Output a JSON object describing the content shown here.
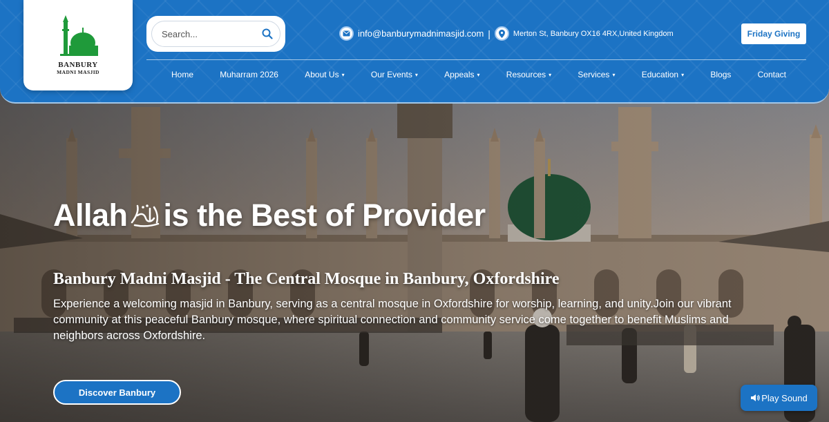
{
  "brand": {
    "logo_title": "BANBURY",
    "logo_sub": "MADNI MASJID",
    "green": "#1f9a3a"
  },
  "colors": {
    "primary": "#1c73c4",
    "white": "#ffffff"
  },
  "search": {
    "placeholder": "Search...",
    "icon": "search-icon"
  },
  "contact": {
    "email": "info@banburymadnimasjid.com",
    "separator": "|",
    "address": "Merton St, Banbury OX16 4RX,United Kingdom",
    "email_icon": "email-icon",
    "location_icon": "location-pin-icon"
  },
  "header_button": {
    "label": "Friday Giving"
  },
  "nav": {
    "items": [
      {
        "label": "Home",
        "dropdown": false
      },
      {
        "label": "Muharram 2026",
        "dropdown": false
      },
      {
        "label": "About Us",
        "dropdown": true
      },
      {
        "label": "Our Events",
        "dropdown": true
      },
      {
        "label": "Appeals",
        "dropdown": true
      },
      {
        "label": "Resources",
        "dropdown": true
      },
      {
        "label": "Services",
        "dropdown": true
      },
      {
        "label": "Education",
        "dropdown": true
      },
      {
        "label": "Blogs",
        "dropdown": false
      },
      {
        "label": "Contact",
        "dropdown": false
      }
    ],
    "caret": "▾"
  },
  "hero": {
    "title_part1": "Allah",
    "title_part2": "is the Best of Provider",
    "subtitle": "Banbury Madni Masjid - The Central Mosque in Banbury, Oxfordshire",
    "description": "Experience a welcoming masjid in Banbury, serving as a central mosque in Oxfordshire for worship, learning, and unity.Join our vibrant community at this peaceful Banbury mosque, where spiritual connection and community service come together to benefit Muslims and neighbors across Oxfordshire.",
    "cta": "Discover Banbury"
  },
  "sound_button": {
    "label": "Play Sound",
    "icon": "speaker-icon"
  }
}
